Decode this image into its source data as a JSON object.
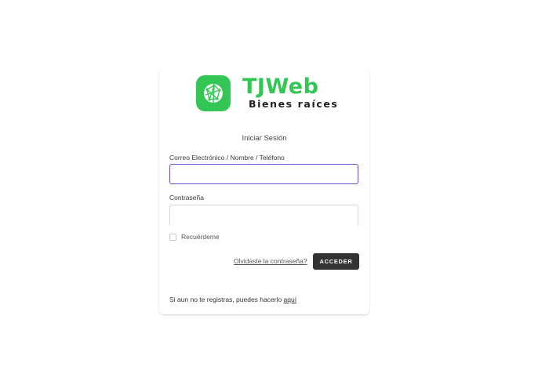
{
  "brand": {
    "name": "TJWeb",
    "tagline": "Bienes raíces",
    "color": "#33c655",
    "icon": "globe-icon"
  },
  "login": {
    "title": "Iniciar Sesión",
    "email_label": "Correo Electrónico / Nombre / Teléfono",
    "email_value": "",
    "password_label": "Contraseña",
    "password_value": "",
    "remember_label": "Recuérdeme",
    "remember_checked": false,
    "forgot_label": "Olvidaste la contraseña?",
    "submit_label": "ACCEDER",
    "register_text": "Si aun no te registras, puedes hacerlo ",
    "register_link": "aquí"
  },
  "colors": {
    "focus_border": "#6450d4",
    "button_bg": "#333333"
  }
}
